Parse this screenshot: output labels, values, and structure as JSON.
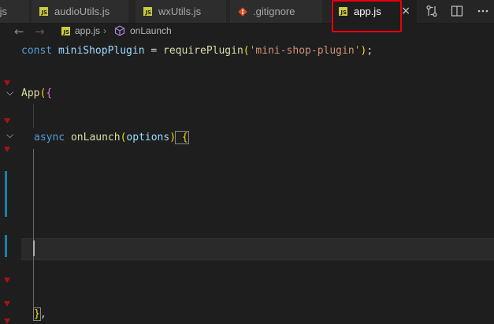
{
  "tabs": [
    {
      "label": ".js"
    },
    {
      "label": "audioUtils.js"
    },
    {
      "label": "wxUtils.js"
    },
    {
      "label": ".gitignore"
    },
    {
      "label": "app.js",
      "close": "×"
    }
  ],
  "breadcrumb": {
    "file": "app.js",
    "symbol": "onLaunch"
  },
  "code": {
    "l1_kw": "const ",
    "l1_var": "miniShopPlugin",
    "l1_eq": " = ",
    "l1_fn": "requirePlugin",
    "l1_open": "(",
    "l1_str": "'mini-shop-plugin'",
    "l1_close": ")",
    "l1_end": ";",
    "l2_fn": "App",
    "l2_paren": "(",
    "l2_brace": "{",
    "l3_kw": "async ",
    "l3_fn": "onLaunch",
    "l3_open": "(",
    "l3_param": "options",
    "l3_close": ")",
    "l3_brace": " {",
    "l4_brace": "}",
    "l4_comma": ","
  },
  "colors": {
    "active_tab_highlight": "#e8000d",
    "js_icon": "#cbcb41",
    "git_icon": "#e44d26"
  },
  "icons": {
    "tab_file": "js-file-icon",
    "tab_git": "git-file-icon",
    "toolbar": [
      "compare-changes-icon",
      "split-editor-icon",
      "more-actions-icon"
    ],
    "nav": [
      "arrow-left-icon",
      "arrow-right-icon"
    ],
    "symbol": "method-symbol-icon"
  }
}
